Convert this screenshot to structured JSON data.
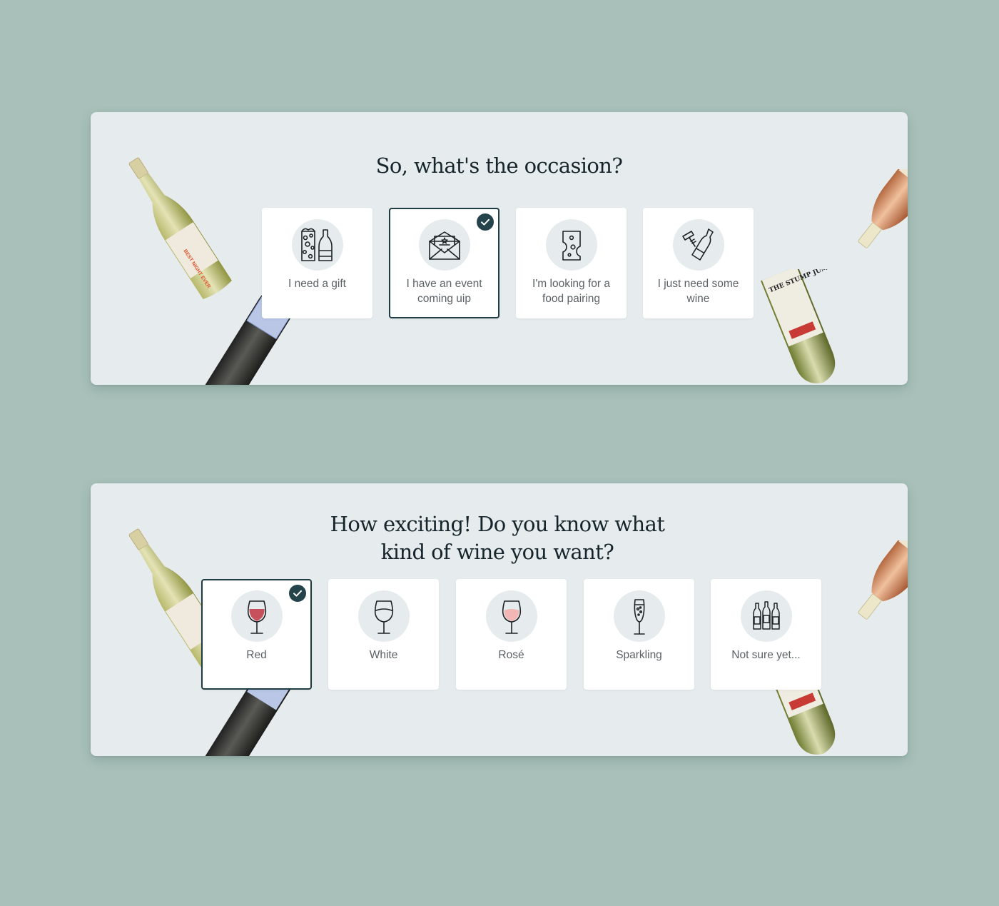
{
  "occasion_panel": {
    "title": "So, what's the occasion?",
    "options": [
      {
        "label": "I need a gift",
        "icon": "gift-bottle-icon",
        "selected": false
      },
      {
        "label": "I have an event coming uip",
        "icon": "invitation-icon",
        "selected": true
      },
      {
        "label": "I'm looking for a food pairing",
        "icon": "cheese-icon",
        "selected": false
      },
      {
        "label": "I just need some wine",
        "icon": "corkscrew-bottle-icon",
        "selected": false
      }
    ]
  },
  "wine_type_panel": {
    "title": "How exciting! Do you know what kind of wine you want?",
    "options": [
      {
        "label": "Red",
        "icon": "red-wine-glass-icon",
        "selected": true
      },
      {
        "label": "White",
        "icon": "white-wine-glass-icon",
        "selected": false
      },
      {
        "label": "Rosé",
        "icon": "rose-wine-glass-icon",
        "selected": false
      },
      {
        "label": "Sparkling",
        "icon": "champagne-flute-icon",
        "selected": false
      },
      {
        "label": "Not sure yet...",
        "icon": "three-bottles-icon",
        "selected": false
      }
    ]
  },
  "bottle_labels": {
    "best_night_ever": "BEST NIGHT EVER",
    "the_stump_jump": "THE STUMP JUMP"
  },
  "colors": {
    "background": "#a8c0b9",
    "panel": "#e6ecee",
    "selected_border": "#1f3d42",
    "check_badge": "#24434a",
    "red_wine": "#c6515c",
    "rose_wine": "#f2b7b4"
  }
}
